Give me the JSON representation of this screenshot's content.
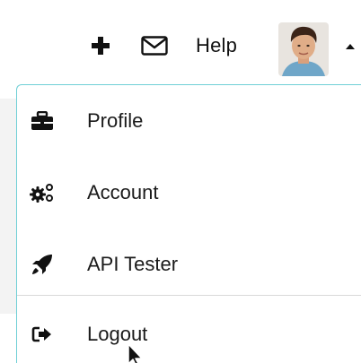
{
  "header": {
    "add_icon": "plus-icon",
    "mail_icon": "envelope-icon",
    "help_label": "Help",
    "avatar_icon": "user-avatar",
    "caret_icon": "caret-up-icon"
  },
  "menu": {
    "items": [
      {
        "label": "Profile",
        "icon": "briefcase-icon"
      },
      {
        "label": "Account",
        "icon": "gears-icon"
      },
      {
        "label": "API Tester",
        "icon": "rocket-icon"
      },
      {
        "label": "Logout",
        "icon": "sign-out-icon"
      }
    ]
  },
  "colors": {
    "menu_border": "#6fcfd6",
    "text": "#1a1a1a",
    "divider": "#d9d9d9"
  }
}
